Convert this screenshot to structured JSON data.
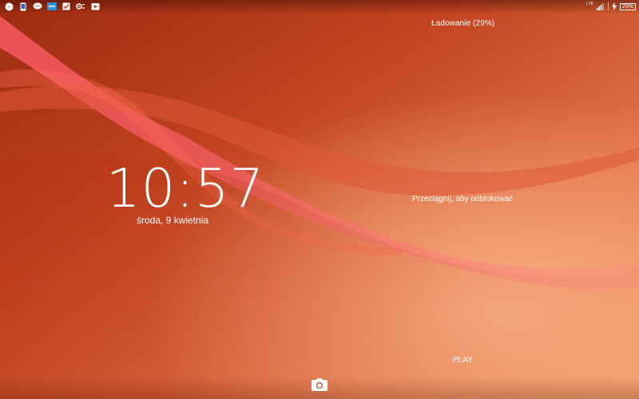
{
  "status_bar": {
    "left_icons": [
      "messenger-icon",
      "sms-icon",
      "chat-icon",
      "app-icon",
      "checkbox-icon",
      "settings-icon",
      "video-icon"
    ],
    "network_label": "LTE",
    "battery_percent": "29%"
  },
  "lockscreen": {
    "charging_status": "Ładowanie (29%)",
    "clock": "10:57",
    "date": "środa, 9 kwietnia",
    "unlock_hint": "Przeciągnij, aby odblokować",
    "music_label": "PLAY"
  },
  "colors": {
    "accent": "#d9502a",
    "wallpaper_dark": "#a8300f",
    "wallpaper_light": "#f7a277"
  }
}
